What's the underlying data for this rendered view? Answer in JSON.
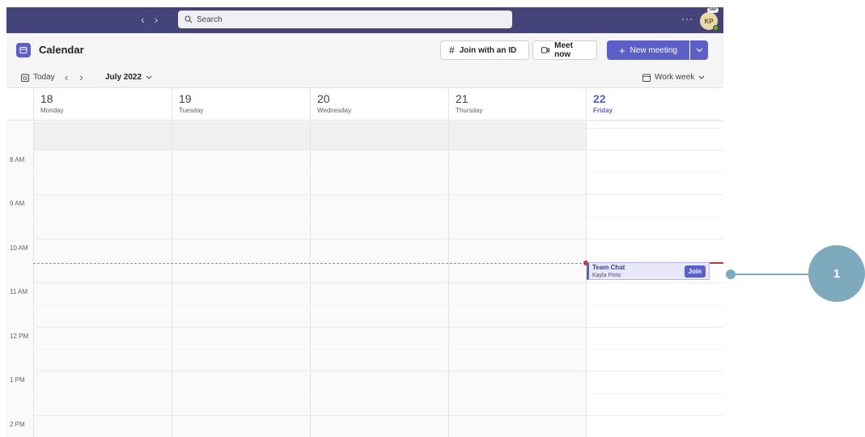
{
  "titlebar": {
    "search_placeholder": "Search",
    "more_label": "···",
    "avatar_initials": "KP",
    "avatar_badge": "TAP",
    "back_icon": "chevron-left-icon",
    "forward_icon": "chevron-right-icon"
  },
  "header": {
    "app_title": "Calendar",
    "join_id_label": "Join with an ID",
    "meet_now_label": "Meet now",
    "new_meeting_label": "New meeting"
  },
  "toolbar": {
    "today_label": "Today",
    "month_label": "July 2022",
    "view_label": "Work week"
  },
  "days": [
    {
      "num": "18",
      "name": "Monday"
    },
    {
      "num": "19",
      "name": "Tuesday"
    },
    {
      "num": "20",
      "name": "Wednesday"
    },
    {
      "num": "21",
      "name": "Thursday"
    },
    {
      "num": "22",
      "name": "Friday"
    }
  ],
  "times": [
    "8 AM",
    "9 AM",
    "10 AM",
    "11 AM",
    "12 PM",
    "1 PM",
    "2 PM"
  ],
  "event": {
    "title": "Team Chat",
    "organizer": "Kayla Pinto",
    "join_label": "Join"
  },
  "callout": {
    "number": "1"
  },
  "colors": {
    "accent": "#5b5fc7",
    "titlebar": "#44447a",
    "now_line": "#c4314b",
    "callout": "#7fa9bd"
  }
}
